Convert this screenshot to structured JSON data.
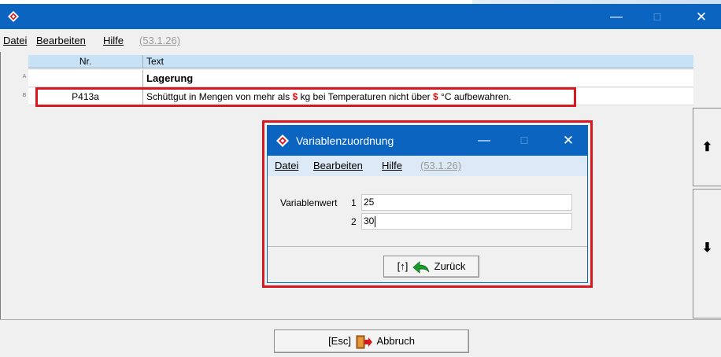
{
  "window": {
    "min_glyph": "—",
    "max_glyph": "☐",
    "close_glyph": "✕"
  },
  "menu": {
    "datei": "Datei",
    "bearbeiten": "Bearbeiten",
    "hilfe": "Hilfe",
    "version": "(53.1.26)"
  },
  "grid": {
    "columns": [
      "Nr.",
      "Text"
    ],
    "rows": [
      {
        "mark": "A",
        "nr": "",
        "text": "Lagerung"
      },
      {
        "mark": "B",
        "nr": "P413a",
        "text_parts": [
          "Schüttgut in Mengen von mehr als ",
          "$",
          " kg bei Temperaturen nicht über ",
          "$",
          " °C aufbewahren."
        ]
      }
    ]
  },
  "scroll": {
    "up_glyph": "⬆",
    "down_glyph": "⬇"
  },
  "bottom": {
    "abbruch_key": "[Esc]",
    "abbruch_label": "Abbruch"
  },
  "dialog": {
    "title": "Variablenzuordnung",
    "menu": {
      "datei": "Datei",
      "bearbeiten": "Bearbeiten",
      "hilfe": "Hilfe",
      "version": "(53.1.26)"
    },
    "label_variablenwert": "Variablenwert",
    "rows": [
      {
        "index": "1",
        "value": "25"
      },
      {
        "index": "2",
        "value": "30"
      }
    ],
    "zurueck_key": "[↑]",
    "zurueck_label": "Zurück"
  },
  "colors": {
    "titlebar": "#0b64c0",
    "highlight": "#d7191f",
    "variable": "#e01010",
    "header": "#c7e2f7"
  }
}
